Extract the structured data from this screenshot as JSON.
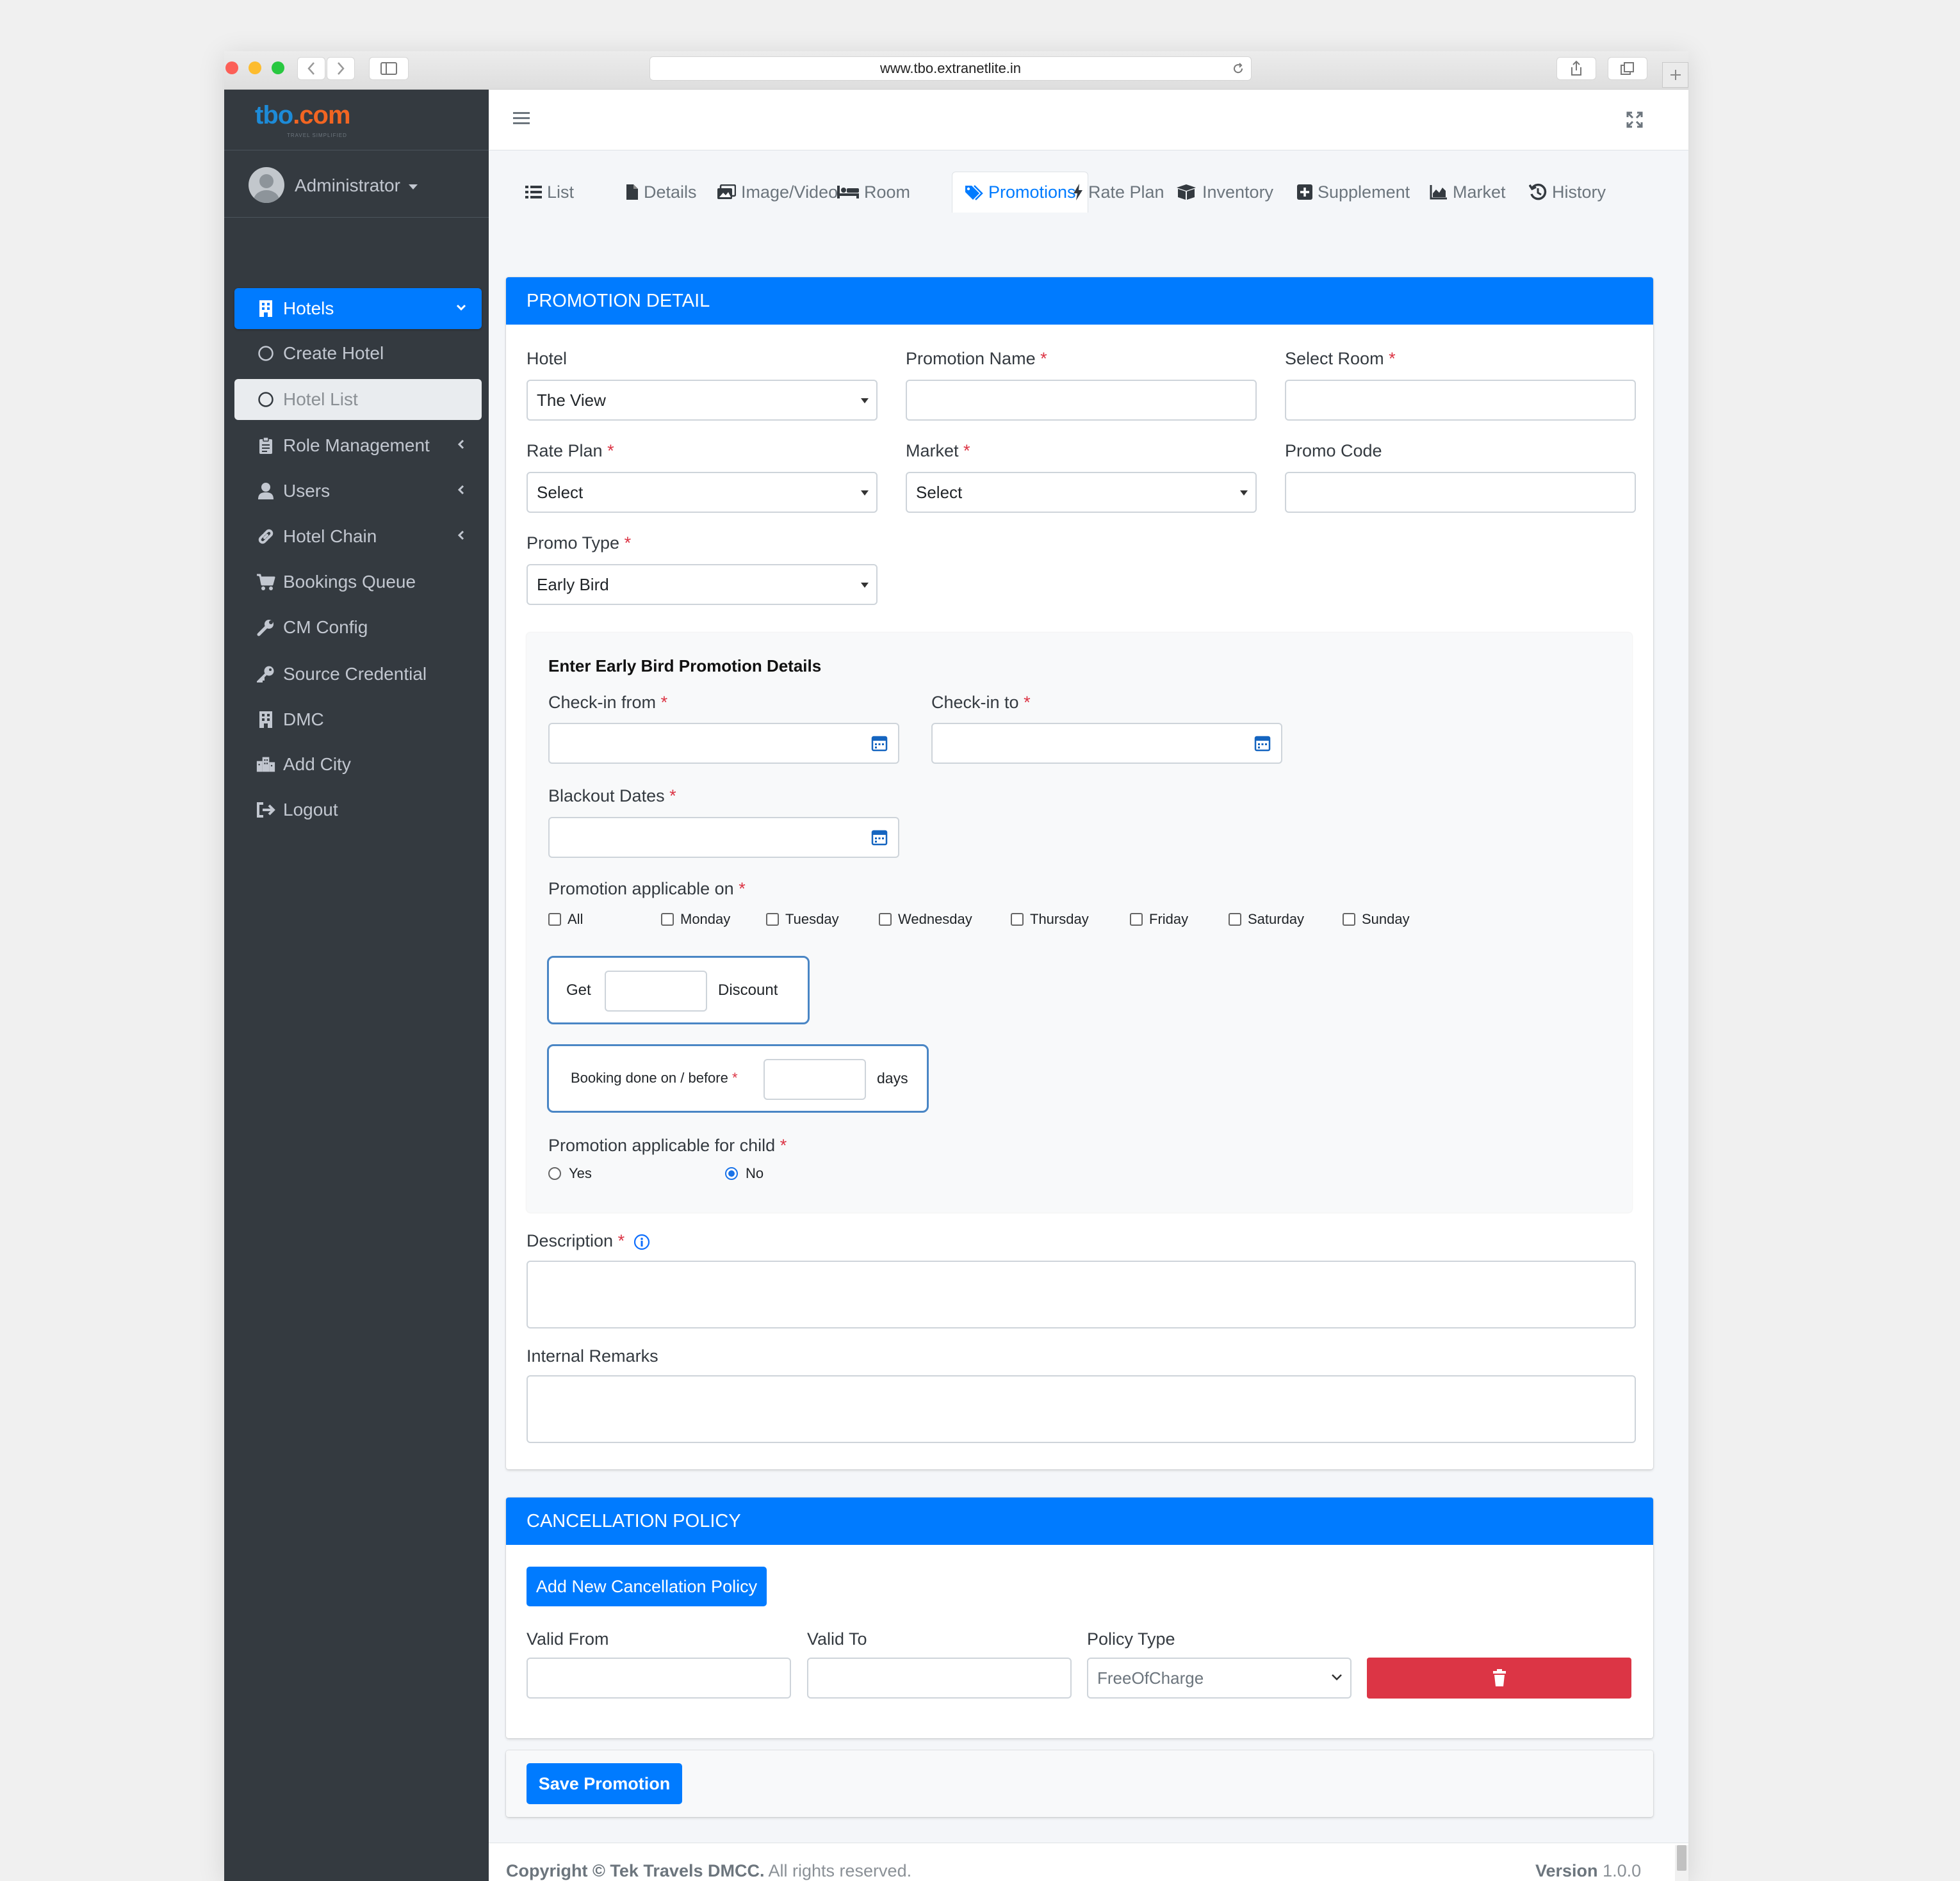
{
  "browser": {
    "url": "www.tbo.extranetlite.in"
  },
  "brand": {
    "logo_part1": "tbo",
    "logo_part2": ".com",
    "tagline": "TRAVEL SIMPLIFIED"
  },
  "user": {
    "name": "Administrator"
  },
  "sidebar": {
    "items": [
      {
        "label": "Hotels",
        "icon": "building-icon"
      },
      {
        "label": "Create Hotel",
        "icon": "circle-icon"
      },
      {
        "label": "Hotel List",
        "icon": "circle-icon"
      },
      {
        "label": "Role Management",
        "icon": "clipboard-icon"
      },
      {
        "label": "Users",
        "icon": "user-icon"
      },
      {
        "label": "Hotel Chain",
        "icon": "link-icon"
      },
      {
        "label": "Bookings Queue",
        "icon": "cart-icon"
      },
      {
        "label": "CM Config",
        "icon": "wrench-icon"
      },
      {
        "label": "Source Credential",
        "icon": "key-icon"
      },
      {
        "label": "DMC",
        "icon": "building-icon"
      },
      {
        "label": "Add City",
        "icon": "city-icon"
      },
      {
        "label": "Logout",
        "icon": "logout-icon"
      }
    ]
  },
  "tabs": [
    {
      "label": "List"
    },
    {
      "label": "Details"
    },
    {
      "label": "Image/Video"
    },
    {
      "label": "Room"
    },
    {
      "label": "Promotions"
    },
    {
      "label": "Rate Plan"
    },
    {
      "label": "Inventory"
    },
    {
      "label": "Supplement"
    },
    {
      "label": "Market"
    },
    {
      "label": "History"
    }
  ],
  "promotion": {
    "title": "PROMOTION DETAIL",
    "hotel_label": "Hotel",
    "hotel_value": "The View",
    "promo_name_label": "Promotion Name",
    "select_room_label": "Select Room",
    "rate_plan_label": "Rate Plan",
    "rate_plan_value": "Select",
    "market_label": "Market",
    "market_value": "Select",
    "promo_code_label": "Promo Code",
    "promo_type_label": "Promo Type",
    "promo_type_value": "Early Bird",
    "required_mark": "*"
  },
  "early_bird": {
    "heading": "Enter Early Bird Promotion Details",
    "checkin_from_label": "Check-in from",
    "checkin_to_label": "Check-in to",
    "blackout_label": "Blackout Dates",
    "applicable_on_label": "Promotion applicable on",
    "days": [
      "All",
      "Monday",
      "Tuesday",
      "Wednesday",
      "Thursday",
      "Friday",
      "Saturday",
      "Sunday"
    ],
    "get_label": "Get",
    "discount_label": "Discount",
    "booking_label": "Booking done on / before",
    "days_label": "days",
    "child_label": "Promotion applicable for child",
    "child_options": [
      "Yes",
      "No"
    ],
    "child_selected": "No"
  },
  "description_label": "Description",
  "remarks_label": "Internal Remarks",
  "cancellation": {
    "title": "CANCELLATION POLICY",
    "add_button": "Add New Cancellation Policy",
    "valid_from_label": "Valid From",
    "valid_to_label": "Valid To",
    "policy_type_label": "Policy Type",
    "policy_type_value": "FreeOfCharge"
  },
  "save_button": "Save Promotion",
  "footer": {
    "copyright_bold": "Copyright © Tek Travels DMCC.",
    "copyright_rest": "All rights reserved.",
    "version_label": "Version",
    "version_value": "1.0.0"
  },
  "colors": {
    "primary": "#007bff",
    "sidebar": "#343a40",
    "danger": "#dc3545"
  }
}
